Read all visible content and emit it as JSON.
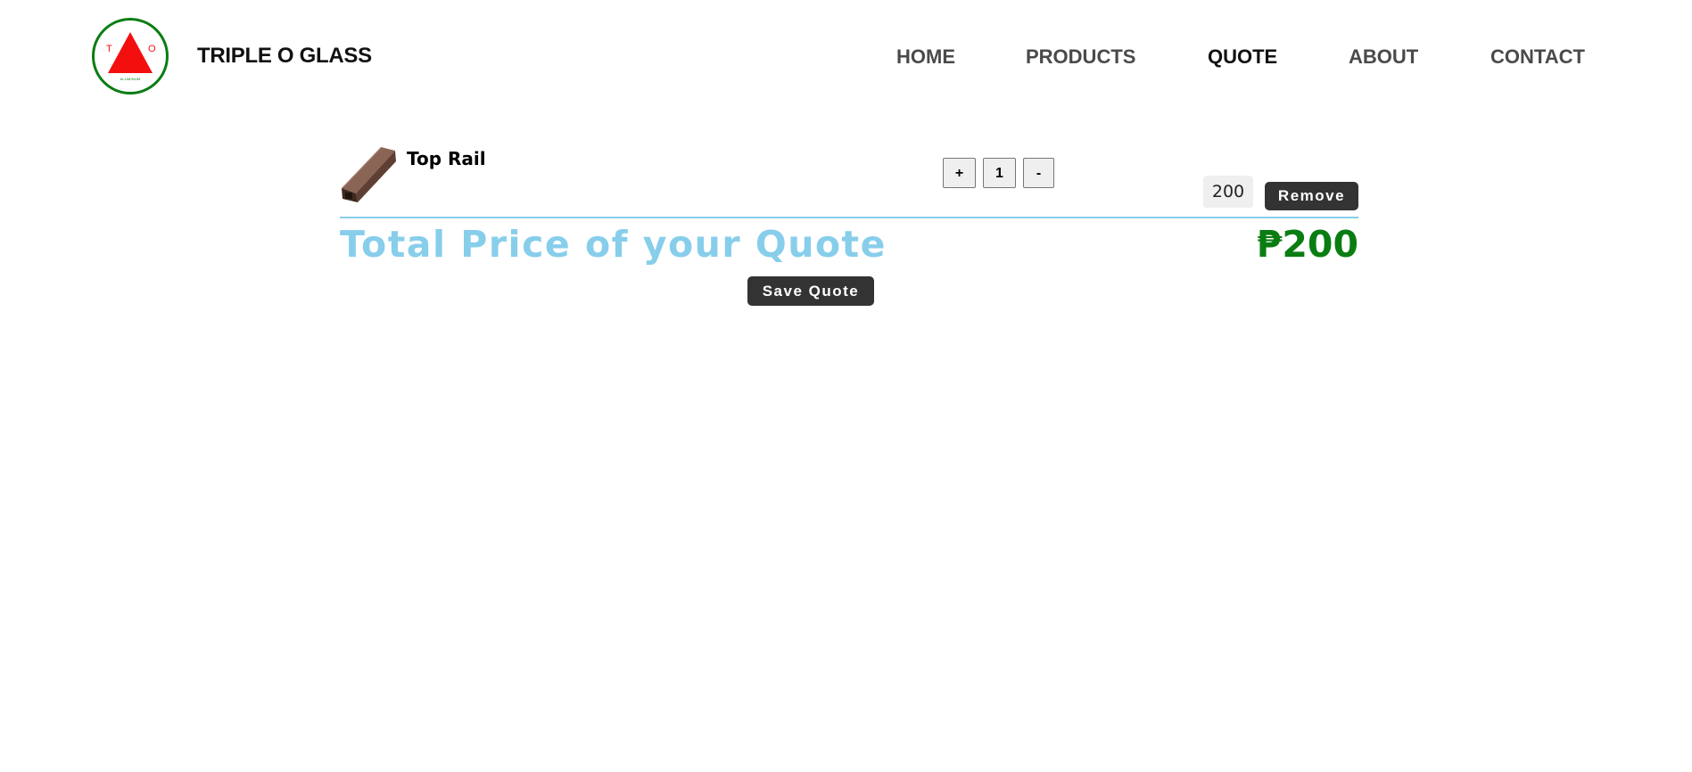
{
  "header": {
    "logo": {
      "letter_left": "T",
      "letter_right": "O",
      "subtext": "ALUMINUM"
    },
    "brand": "TRIPLE O GLASS",
    "nav": [
      {
        "label": "HOME",
        "active": false
      },
      {
        "label": "PRODUCTS",
        "active": false
      },
      {
        "label": "QUOTE",
        "active": true
      },
      {
        "label": "ABOUT",
        "active": false
      },
      {
        "label": "CONTACT",
        "active": false
      }
    ]
  },
  "quote": {
    "items": [
      {
        "name": "Top Rail",
        "thumbnail_icon": "top-rail-profile",
        "plus_label": "+",
        "quantity": "1",
        "minus_label": "-",
        "price": "200",
        "remove_label": "Remove"
      }
    ],
    "total_label": "Total Price of your Quote",
    "total_value": "₱200",
    "save_label": "Save Quote"
  },
  "colors": {
    "logo_ring": "#0a7d12",
    "logo_triangle": "#f40f0f",
    "accent_divider": "#87ceeb",
    "total_label": "#87ceeb",
    "total_value": "#0a7d12",
    "dark_button": "#333333"
  }
}
